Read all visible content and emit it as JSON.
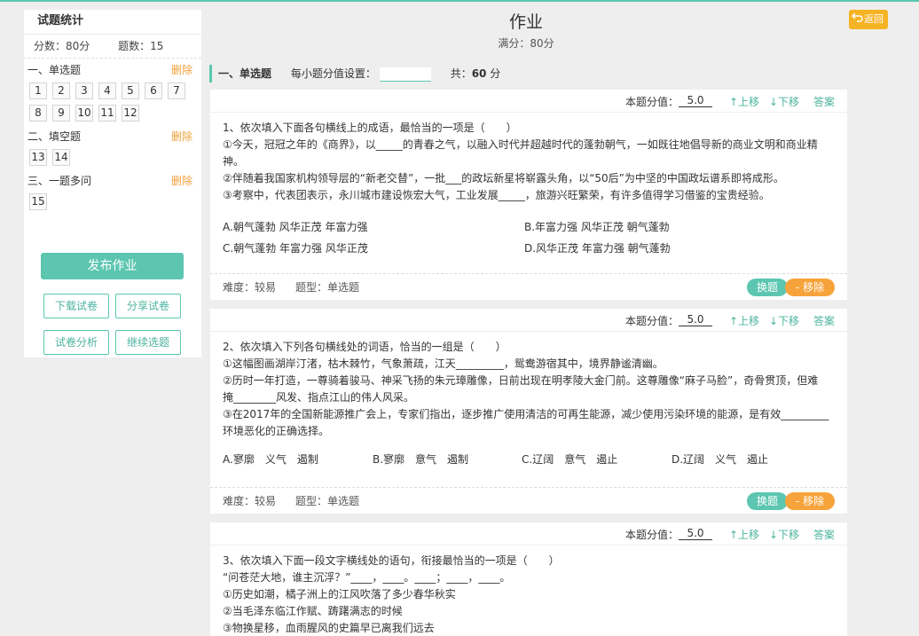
{
  "sidebar": {
    "title": "试题统计",
    "score": "分数：80分",
    "count": "题数：15",
    "sections": [
      {
        "name": "一、单选题",
        "delete": "删除",
        "nums": [
          "1",
          "2",
          "3",
          "4",
          "5",
          "6",
          "7",
          "8",
          "9",
          "10",
          "11",
          "12"
        ]
      },
      {
        "name": "二、填空题",
        "delete": "删除",
        "nums": [
          "13",
          "14"
        ]
      },
      {
        "name": "三、一题多问",
        "delete": "删除",
        "nums": [
          "15"
        ]
      }
    ],
    "publish": "发布作业",
    "download": "下载试卷",
    "share": "分享试卷",
    "analysis": "试卷分析",
    "continue": "继续选题"
  },
  "header": {
    "title": "作业",
    "subtitle": "满分：80分",
    "back": "返回"
  },
  "section_bar": {
    "name": "一、单选题",
    "per_score_label": "每小题分值设置：",
    "total_prefix": "共：",
    "total_value": "60",
    "total_suffix": " 分"
  },
  "card_labels": {
    "score_label": "本题分值：",
    "up": "↑上移",
    "down": "↓下移",
    "answer": "答案",
    "swap": "换题",
    "remove": "- 移除"
  },
  "questions": [
    {
      "score": "5.0",
      "lines": [
        "1、依次填入下面各句横线上的成语，最恰当的一项是（　　）",
        "①今天，冠冠之年的《商界》，以_____的青春之气，以融入时代并超越时代的蓬勃朝气，一如既往地倡导新的商业文明和商业精",
        "神。",
        "②伴随着我国家机构领导层的“新老交替”，一批___的政坛新星将崭露头角，以“50后”为中坚的中国政坛谱系即将成形。",
        "③考察中，代表团表示，永川城市建设恢宏大气，工业发展_____，旅游兴旺繁荣，有许多值得学习借鉴的宝贵经验。"
      ],
      "options": [
        "A.朝气蓬勃  风华正茂  年富力强",
        "B.年富力强  风华正茂  朝气蓬勃",
        "C.朝气蓬勃  年富力强  风华正茂",
        "D.风华正茂  年富力强  朝气蓬勃"
      ],
      "difficulty": "难度：较易",
      "type": "题型：单选题"
    },
    {
      "score": "5.0",
      "lines": [
        "2、依次填入下列各句横线处的词语，恰当的一组是（　　）",
        "①这幅图画湖岸汀渚，枯木棘竹，气象萧疏，江天_________，鸳鸯游宿其中，境界静谧清幽。",
        "②历时一年打造，一尊骑着骏马、神采飞扬的朱元璋雕像，日前出现在明孝陵大金门前。这尊雕像“麻子马脸”，奇骨贯顶，但难",
        "掩________风发、指点江山的伟人风采。",
        "③在2017年的全国新能源推广会上，专家们指出，逐步推广使用清洁的可再生能源，减少使用污染环境的能源，是有效_________",
        "环境恶化的正确选择。"
      ],
      "options": [
        "A.寥廓　义气　遏制",
        "B.寥廓　意气　遏制",
        "C.辽阔　意气　遏止",
        "D.辽阔　义气　遏止"
      ],
      "difficulty": "难度：较易",
      "type": "题型：单选题"
    },
    {
      "score": "5.0",
      "lines": [
        "3、依次填入下面一段文字横线处的语句，衔接最恰当的一项是（　　）",
        "“问苍茫大地，谁主沉浮？”____，____。____；____，____。",
        "①历史如潮，橘子洲上的江风吹落了多少春华秋实",
        "②当毛泽东临江作赋、踌躇满志的时候",
        "③物换星移，血雨腥风的史篇早已离我们远去"
      ]
    }
  ]
}
